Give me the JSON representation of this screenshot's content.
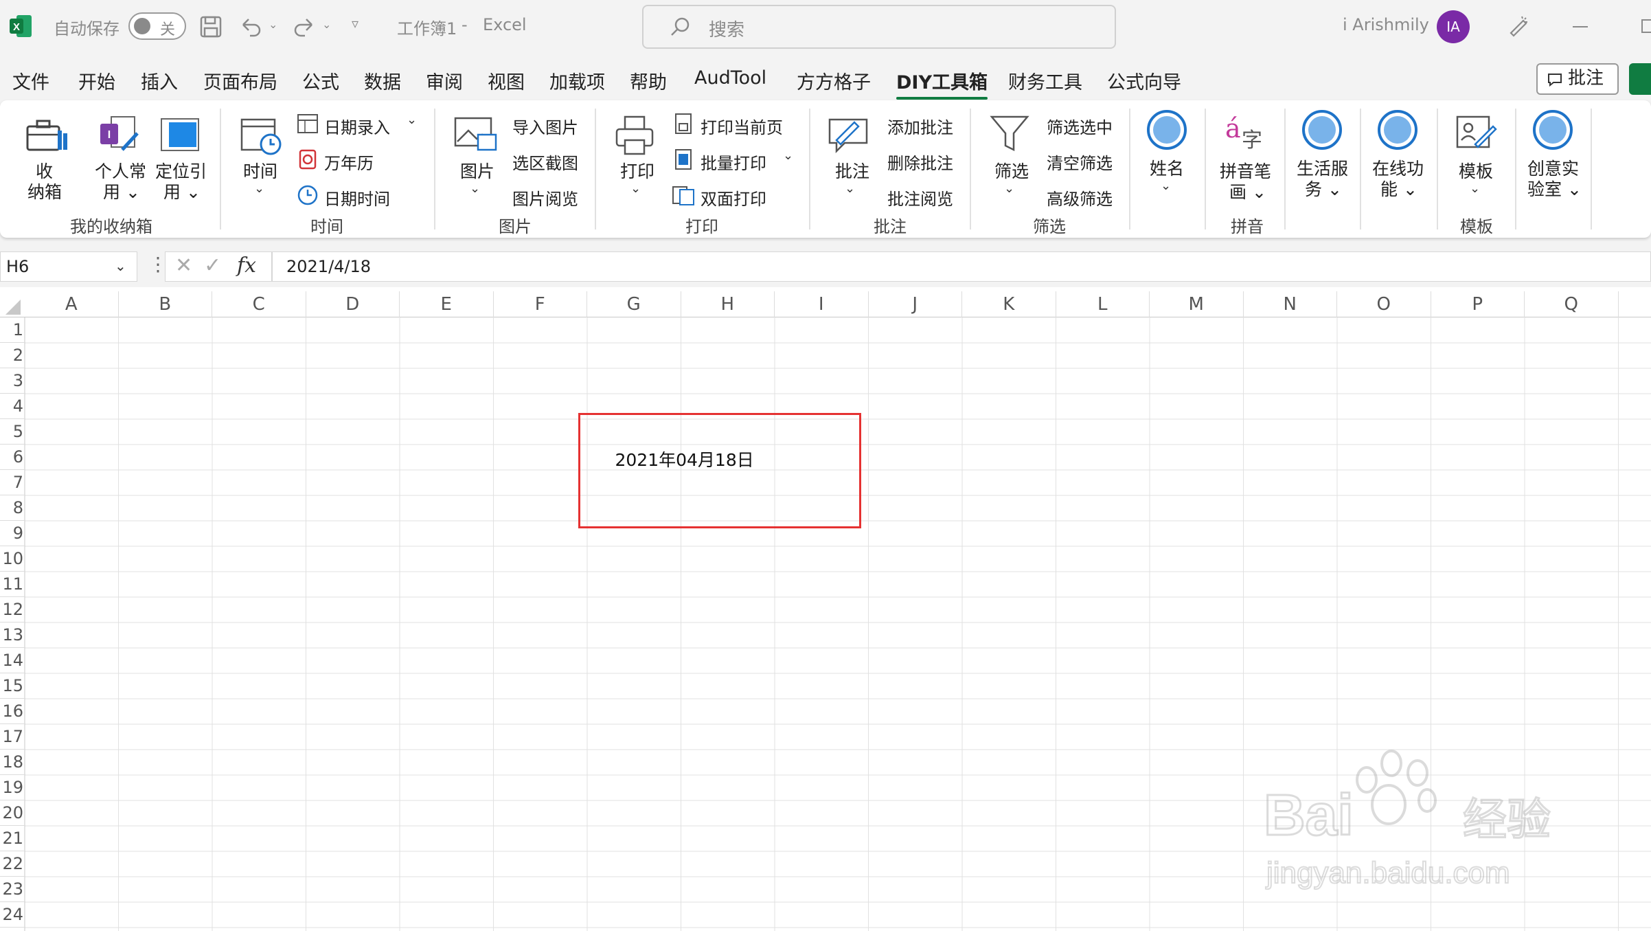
{
  "titlebar": {
    "autosave_label": "自动保存",
    "autosave_state": "关",
    "doc_title": "工作簿1",
    "separator": "-",
    "app_name": "Excel",
    "search_placeholder": "搜索",
    "user_name": "i Arishmily",
    "user_initials": "IA"
  },
  "menu": {
    "tabs": [
      "文件",
      "开始",
      "插入",
      "页面布局",
      "公式",
      "数据",
      "审阅",
      "视图",
      "加载项",
      "帮助",
      "AudTool",
      "方方格子",
      "DIY工具箱",
      "财务工具",
      "公式向导"
    ],
    "active_tab": "DIY工具箱",
    "comments_button": "批注"
  },
  "ribbon": {
    "g1": {
      "btn1": "收\n纳箱",
      "btn2": "个人常\n用",
      "btn3": "定位引\n用",
      "label": "我的收纳箱"
    },
    "g2": {
      "btn_time": "时间",
      "date_entry": "日期录入",
      "calendar": "万年历",
      "datetime": "日期时间",
      "label": "时间"
    },
    "g3": {
      "btn_image": "图片",
      "import": "导入图片",
      "screenshot": "选区截图",
      "browse": "图片阅览",
      "label": "图片"
    },
    "g4": {
      "btn_print": "打印",
      "current": "打印当前页",
      "batch": "批量打印",
      "duplex": "双面打印",
      "label": "打印"
    },
    "g5": {
      "btn_comment": "批注",
      "add": "添加批注",
      "delete": "删除批注",
      "browse": "批注阅览",
      "label": "批注"
    },
    "g6": {
      "btn_filter": "筛选",
      "sel": "筛选选中",
      "clear": "清空筛选",
      "adv": "高级筛选",
      "label": "筛选"
    },
    "g7": {
      "btn_name": "姓名"
    },
    "g8": {
      "btn_pinyin": "拼音笔\n画",
      "label": "拼音"
    },
    "g9": {
      "btn_life": "生活服\n务"
    },
    "g10": {
      "btn_online": "在线功\n能"
    },
    "g11": {
      "btn_template": "模板",
      "label": "模板"
    },
    "g12": {
      "btn_lab": "创意实\n验室"
    }
  },
  "formula_bar": {
    "name_box": "H6",
    "fx": "fx",
    "value": "2021/4/18"
  },
  "sheet": {
    "columns": [
      "A",
      "B",
      "C",
      "D",
      "E",
      "F",
      "G",
      "H",
      "I",
      "J",
      "K",
      "L",
      "M",
      "N",
      "O",
      "P",
      "Q"
    ],
    "rows": [
      "1",
      "2",
      "3",
      "4",
      "5",
      "6",
      "7",
      "8",
      "9",
      "10",
      "11",
      "12",
      "13",
      "14",
      "15",
      "16",
      "17",
      "18",
      "19",
      "20",
      "21",
      "22",
      "23",
      "24"
    ],
    "cell_h6": "2021年04月18日"
  },
  "watermark": {
    "brand": "Bai",
    "brand_cn": "经验",
    "url": "jingyan.baidu.com"
  },
  "colors": {
    "excel_green": "#107c41",
    "highlight_red": "#e53232",
    "avatar": "#7a2aa6",
    "ribbon_blue": "#1e73c8"
  }
}
